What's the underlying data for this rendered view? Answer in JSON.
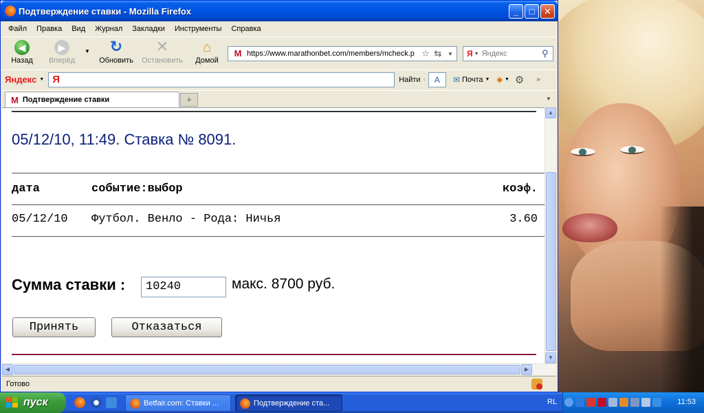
{
  "window": {
    "title": "Подтверждение ставки - Mozilla Firefox",
    "buttons": {
      "minimize": "_",
      "maximize": "□",
      "close": "✕"
    }
  },
  "menu": [
    "Файл",
    "Правка",
    "Вид",
    "Журнал",
    "Закладки",
    "Инструменты",
    "Справка"
  ],
  "nav": {
    "back": "Назад",
    "forward": "Вперёд",
    "reload": "Обновить",
    "stop": "Остановить",
    "home": "Домой"
  },
  "address": {
    "url": "https://www.marathonbet.com/members/mcheck.p",
    "favicon": "M"
  },
  "search": {
    "placeholder": "Яндекс",
    "engine_icon": "Я"
  },
  "yandex_bar": {
    "logo": "Яндекс",
    "input_glyph": "Я",
    "find": "Найти",
    "mail": "Почта"
  },
  "tab": {
    "title": "Подтверждение ставки",
    "favicon": "M"
  },
  "page": {
    "bet_header": "05/12/10, 11:49. Ставка № 8091.",
    "columns": {
      "date": "дата",
      "event": "событие:выбор",
      "odds": "коэф."
    },
    "row": {
      "date": "05/12/10",
      "event": "Футбол. Венло - Рода: Ничья",
      "odds": "3.60"
    },
    "stake_label": "Сумма ставки :",
    "stake_value": "10240",
    "stake_max": "макс. 8700 руб.",
    "accept_button": "Принять",
    "decline_button": "Отказаться"
  },
  "status": {
    "text": "Готово"
  },
  "taskbar": {
    "start": "пуск",
    "tasks": [
      "Betfair.com: Ставки ...",
      "Подтверждение ста..."
    ],
    "lang": "RL",
    "clock": "11:53"
  },
  "colors": {
    "title_blue": "#0054e3",
    "heading_text": "#0a1f7a",
    "bottom_rule": "#8b1a3a",
    "start_green": "#3c9e3c"
  }
}
